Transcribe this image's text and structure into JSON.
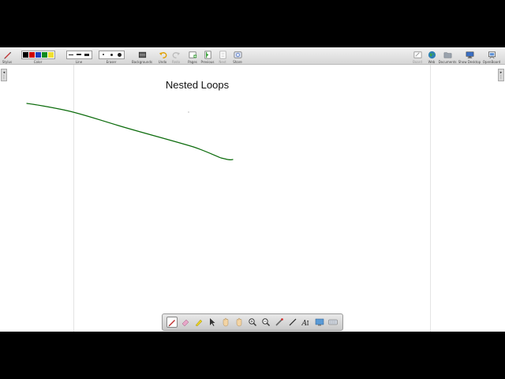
{
  "toolbar": {
    "stylus_label": "Stylus",
    "color_label": "Color",
    "line_label": "Line",
    "eraser_label": "Eraser",
    "backgrounds_label": "Backgrounds",
    "undo_label": "Undo",
    "redo_label": "Redo",
    "pages_label": "Pages",
    "previous_label": "Previous",
    "next_label": "Next",
    "share_label": "Share",
    "board_label": "Board",
    "web_label": "Web",
    "documents_label": "Documents",
    "show_desktop_label": "Show Desktop",
    "openboard_label": "OpenBoard",
    "colors": [
      "#000000",
      "#d10000",
      "#1a3fbf",
      "#0f8a1e",
      "#f0e030"
    ]
  },
  "canvas": {
    "title": "Nested Loops",
    "ink_color": "#0b6b0b"
  },
  "side_controls": {
    "left_arrow": "◂",
    "left_dots": "⋮",
    "right_arrow": "▸",
    "right_dots": "⋮"
  },
  "bottom_tools": [
    {
      "name": "pen-tool",
      "icon": "pen-icon",
      "active": true
    },
    {
      "name": "eraser-tool",
      "icon": "eraser-icon"
    },
    {
      "name": "marker-tool",
      "icon": "marker-icon"
    },
    {
      "name": "selector-tool",
      "icon": "arrow-cursor-icon"
    },
    {
      "name": "play-tool",
      "icon": "hand-icon"
    },
    {
      "name": "hand-tool",
      "icon": "hand-icon"
    },
    {
      "name": "zoom-in-tool",
      "icon": "zoom-in-icon"
    },
    {
      "name": "zoom-out-tool",
      "icon": "zoom-out-icon"
    },
    {
      "name": "laser-pointer-tool",
      "icon": "laser-pointer-icon"
    },
    {
      "name": "line-tool",
      "icon": "line-icon"
    },
    {
      "name": "text-tool",
      "icon": "text-icon"
    },
    {
      "name": "capture-tool",
      "icon": "capture-icon"
    },
    {
      "name": "virtual-keyboard-tool",
      "icon": "keyboard-icon"
    }
  ],
  "bottom_tool_labels": {
    "text": "Aa"
  }
}
